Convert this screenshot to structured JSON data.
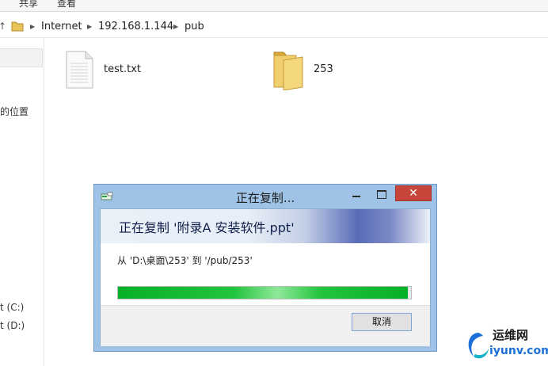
{
  "ribbon": {
    "tabs": [
      "共享",
      "查看"
    ]
  },
  "address_bar": {
    "segments": [
      "Internet",
      "192.168.1.144",
      "pub"
    ]
  },
  "nav_pane": {
    "items": [
      "的位置",
      "t (C:)",
      "t (D:)"
    ]
  },
  "files": [
    {
      "name": "test.txt",
      "icon": "text-file-icon"
    },
    {
      "name": "253",
      "icon": "folder-icon"
    }
  ],
  "dialog": {
    "title": "正在复制...",
    "close_glyph": "✕",
    "heading": "正在复制 '附录A 安装软件.ppt'",
    "from_to": "从 'D:\\桌面\\253' 到 '/pub/253'",
    "progress": 0.99,
    "cancel_label": "取消",
    "progress_color": "#06b025",
    "close_color": "#c7463b"
  },
  "watermark": {
    "line1": "运维网",
    "line2": "iyunv.com"
  }
}
